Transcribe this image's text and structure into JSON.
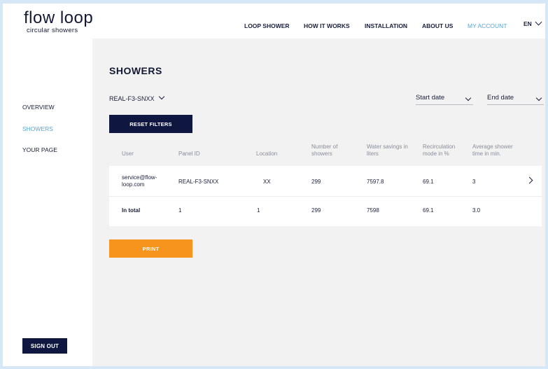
{
  "brand": {
    "name": "flow loop",
    "tagline": "circular showers"
  },
  "nav": {
    "items": [
      "LOOP SHOWER",
      "HOW IT WORKS",
      "INSTALLATION",
      "ABOUT US",
      "MY ACCOUNT"
    ],
    "active": "MY ACCOUNT",
    "language": "EN"
  },
  "sidebar": {
    "items": [
      "OVERVIEW",
      "SHOWERS",
      "YOUR PAGE"
    ],
    "active": "SHOWERS",
    "sign_out": "SIGN OUT"
  },
  "main": {
    "title": "SHOWERS",
    "serial_filter": "REAL-F3-SNXX",
    "start_date": "Start date",
    "end_date": "End date",
    "reset_button": "RESET FILTERS",
    "print_button": "PRINT",
    "columns": [
      "User",
      "Panel ID",
      "Location",
      "Number of showers",
      "Water savings in liters",
      "Recirculation mode in %",
      "Average shower time in min."
    ],
    "rows": [
      {
        "user": "service@flow-loop.com",
        "panel_id": "REAL-F3-SNXX",
        "location": "XX",
        "showers": "299",
        "water": "7597.8",
        "recirc": "69.1",
        "avg": "3"
      }
    ],
    "total": {
      "label": "In total",
      "panel_id": "1",
      "location": "1",
      "showers": "299",
      "water": "7598",
      "recirc": "69.1",
      "avg": "3.0"
    }
  },
  "colors": {
    "navy": "#0f1640",
    "accent": "#56a8d6",
    "orange": "#f7941d",
    "background": "#f2f2f3"
  }
}
